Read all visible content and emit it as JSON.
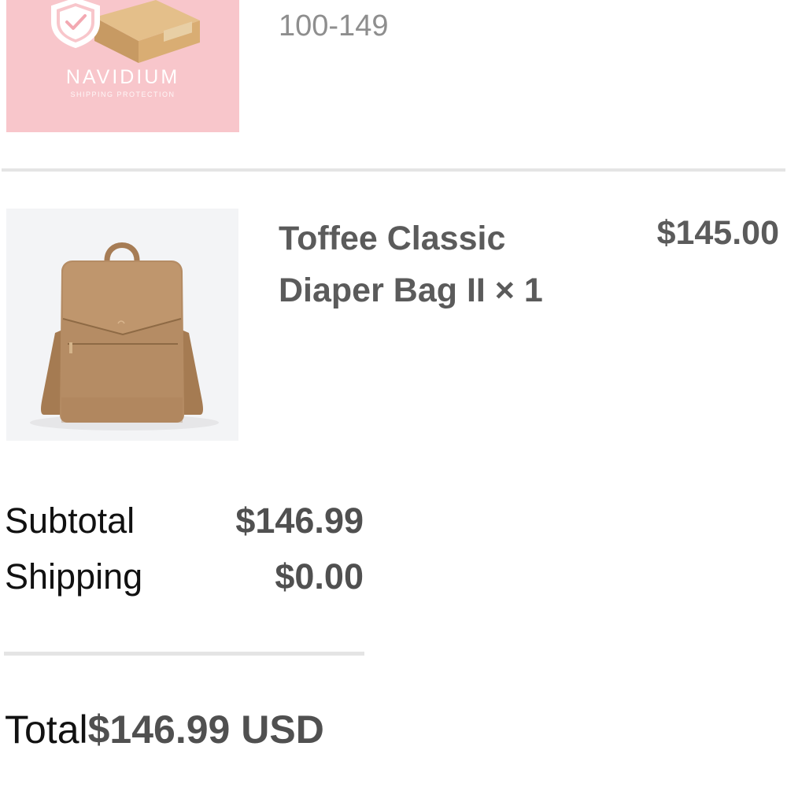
{
  "items": [
    {
      "image": {
        "icon": "shield-check-package-icon",
        "brand": "NAVIDIUM",
        "tagline": "SHIPPING PROTECTION",
        "background": "#f8c6cb"
      },
      "variant": "100-149"
    },
    {
      "image": {
        "icon": "diaper-backpack-image",
        "background": "#f3f4f6",
        "product_color": "#b58c64"
      },
      "name_line1": "Toffee Classic",
      "name_line2": "Diaper Bag II × 1",
      "price": "$145.00"
    }
  ],
  "summary": {
    "subtotal_label": "Subtotal",
    "subtotal_value": "$146.99",
    "shipping_label": "Shipping",
    "shipping_value": "$0.00",
    "total_label": "Total",
    "total_value": "$146.99 USD"
  },
  "colors": {
    "divider": "#e4e4e4",
    "muted_text": "#8e8e8e",
    "value_text": "#505050",
    "label_text": "#111111"
  }
}
